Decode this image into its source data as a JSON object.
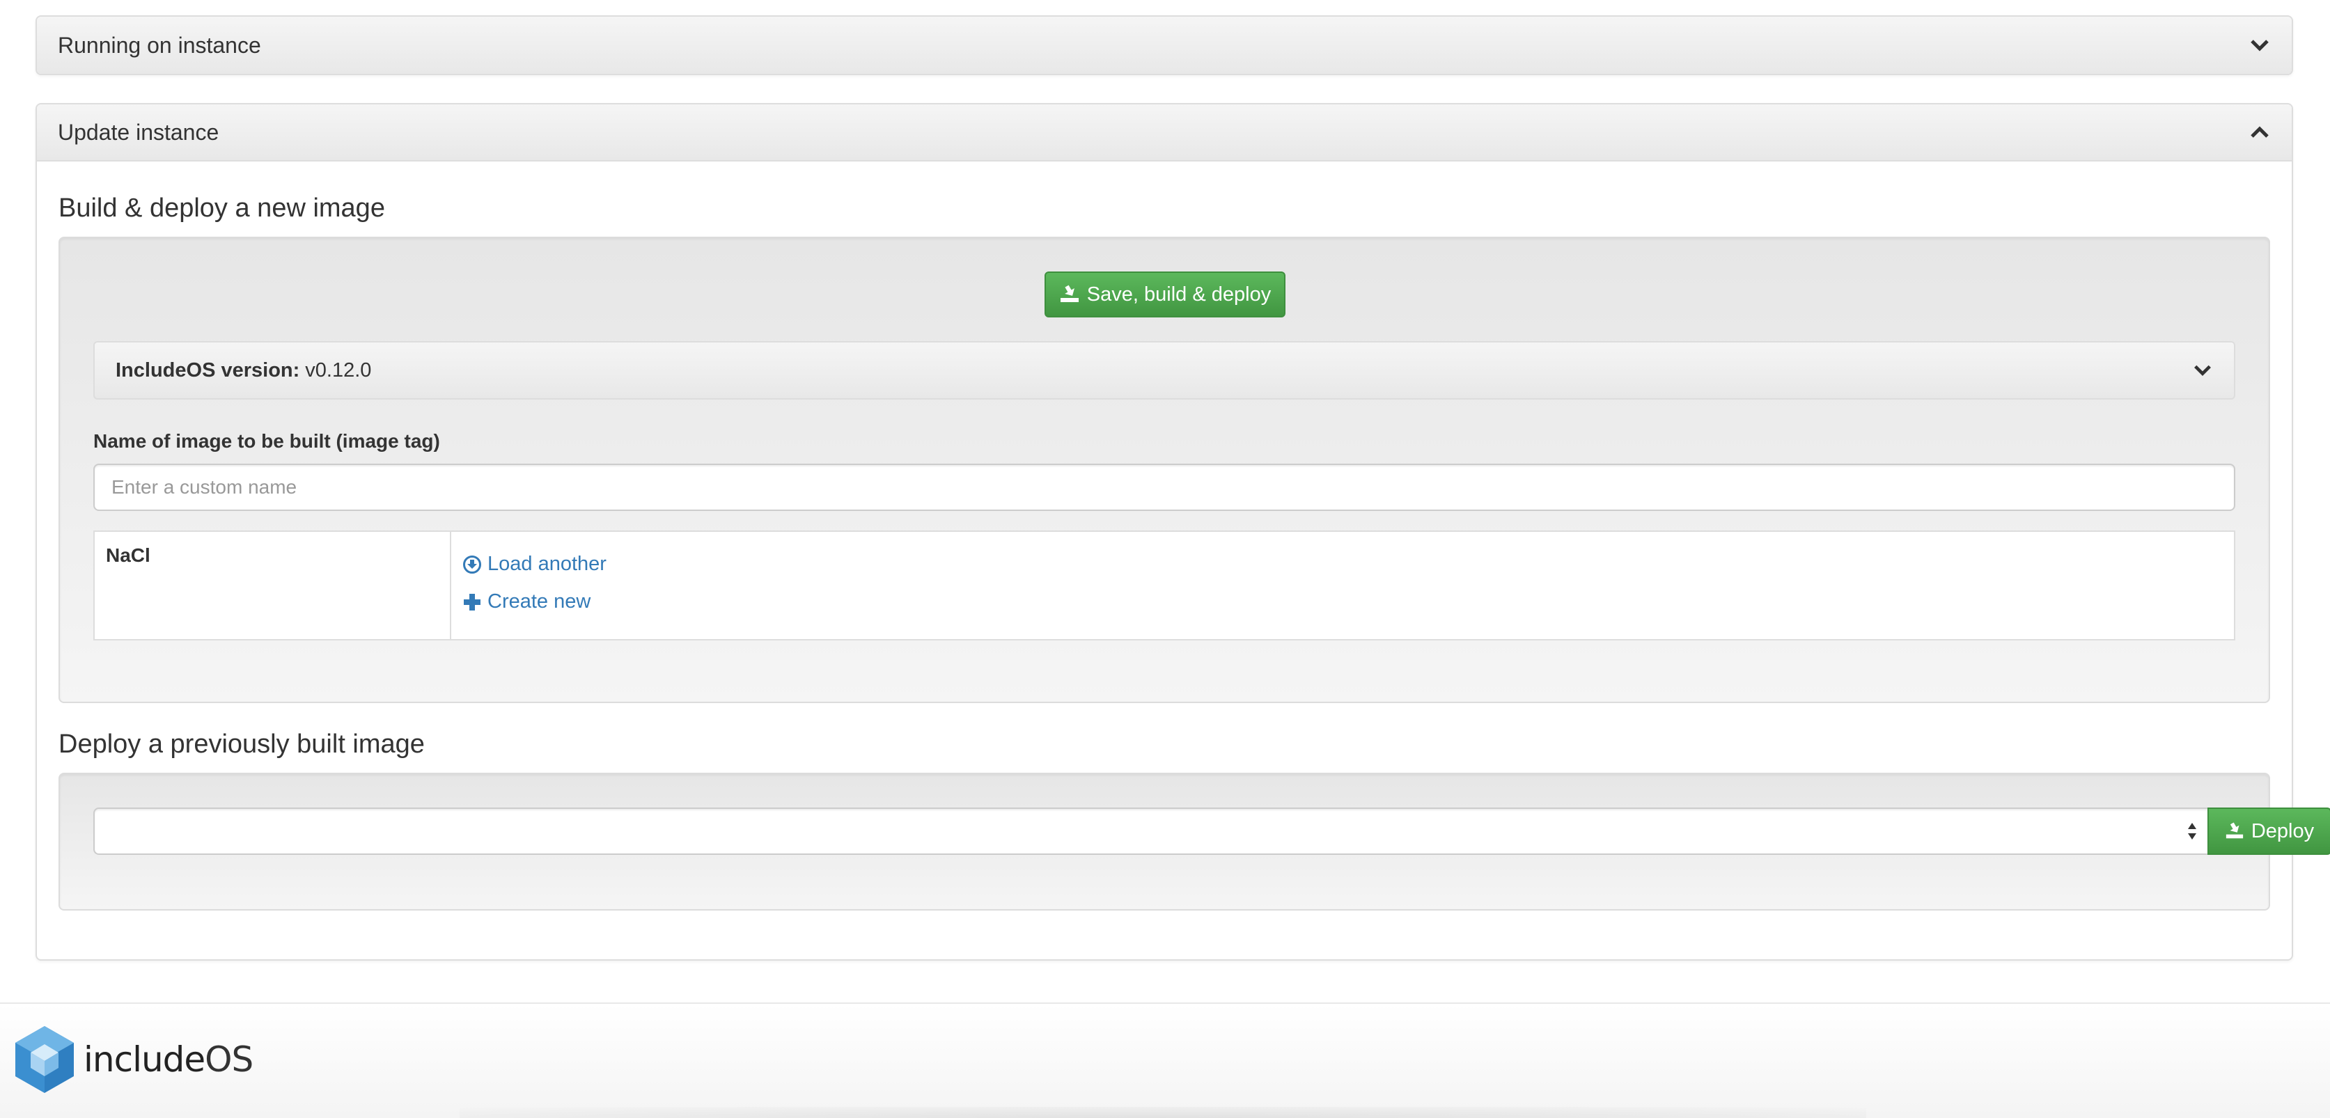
{
  "panels": {
    "running": {
      "title": "Running on instance"
    },
    "update": {
      "title": "Update instance"
    }
  },
  "build": {
    "title": "Build & deploy a new image",
    "save_button": "Save, build & deploy",
    "version_label": "IncludeOS version:",
    "version_value": "v0.12.0",
    "image_name_label": "Name of image to be built (image tag)",
    "image_name_placeholder": "Enter a custom name",
    "image_name_value": "",
    "service": {
      "name": "NaCl",
      "load_another": "Load another",
      "create_new": "Create new"
    }
  },
  "deploy": {
    "title": "Deploy a previously built image",
    "selected": "",
    "deploy_button": "Deploy"
  },
  "footer": {
    "logo_include": "include",
    "logo_os": "OS"
  },
  "colors": {
    "success": "#5cb85c",
    "link": "#337ab7",
    "logo_blue": "#4a9fd8"
  },
  "icons": {
    "panel_collapsed": "chevron-down-icon",
    "panel_expanded": "chevron-up-icon",
    "save": "download-tray-icon",
    "load": "circle-arrow-down-icon",
    "create": "plus-icon",
    "select": "sort-arrows-icon"
  }
}
